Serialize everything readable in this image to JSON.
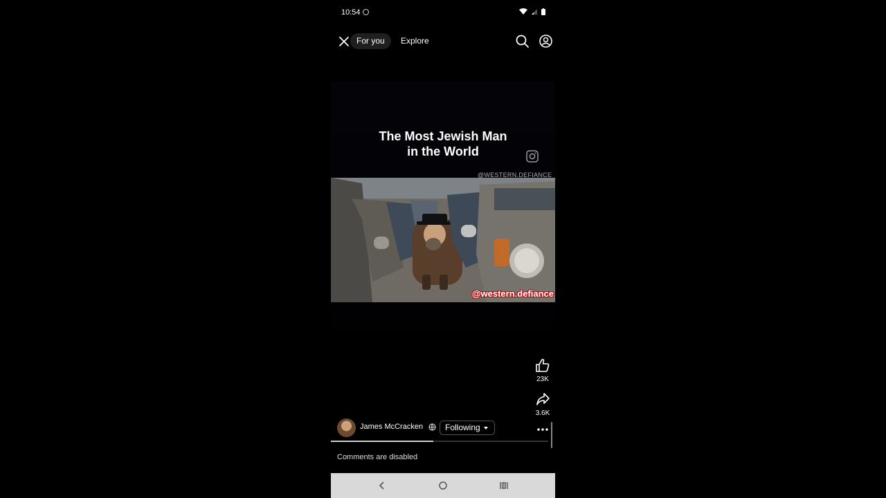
{
  "status_bar": {
    "time": "10:54"
  },
  "nav": {
    "tabs": [
      {
        "label": "For you",
        "active": true
      },
      {
        "label": "Explore",
        "active": false
      }
    ]
  },
  "post": {
    "caption_lines": [
      "The Most Jewish Man",
      "in the World"
    ],
    "watermark_top": "@WESTERN.DEFIANCE",
    "watermark_bottom": "@western.defiance",
    "likes": "23K",
    "shares": "3.6K",
    "progress_fraction": 0.47
  },
  "author": {
    "name": "James McCracken",
    "follow_label": "Following"
  },
  "comments_note": "Comments are disabled",
  "icons": [
    "close-icon",
    "search-icon",
    "profile-icon",
    "instagram-icon",
    "like-icon",
    "share-icon",
    "more-icon",
    "globe-icon",
    "back-icon",
    "home-icon",
    "recents-icon"
  ]
}
